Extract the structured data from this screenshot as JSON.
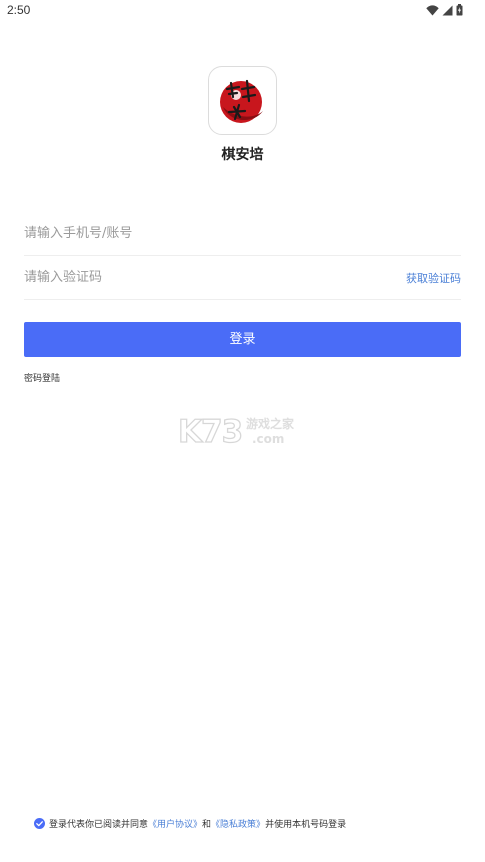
{
  "status_bar": {
    "time": "2:50",
    "icons": [
      "wifi-icon",
      "signal-icon",
      "battery-icon"
    ]
  },
  "app": {
    "name": "棋安培",
    "logo_icon": "app-logo-icon",
    "logo_text": "棋安培"
  },
  "login_form": {
    "phone_placeholder": "请输入手机号/账号",
    "phone_value": "",
    "code_placeholder": "请输入验证码",
    "code_value": "",
    "get_code_label": "获取验证码",
    "login_button_label": "登录",
    "password_login_label": "密码登陆"
  },
  "watermark": {
    "brand": "K73",
    "text": "游戏之家",
    "domain": ".com"
  },
  "agreement": {
    "prefix": "登录代表你已阅读并同意",
    "user_agreement": "《用户协议》",
    "conjunction": "和",
    "privacy_policy": "《隐私政策》",
    "suffix": "并使用本机号码登录",
    "checked": true
  },
  "colors": {
    "accent": "#4a6cf7",
    "link": "#4a7fd6",
    "logo_red": "#c8161d",
    "placeholder": "#9a9a9a",
    "divider": "#eeeeee"
  }
}
